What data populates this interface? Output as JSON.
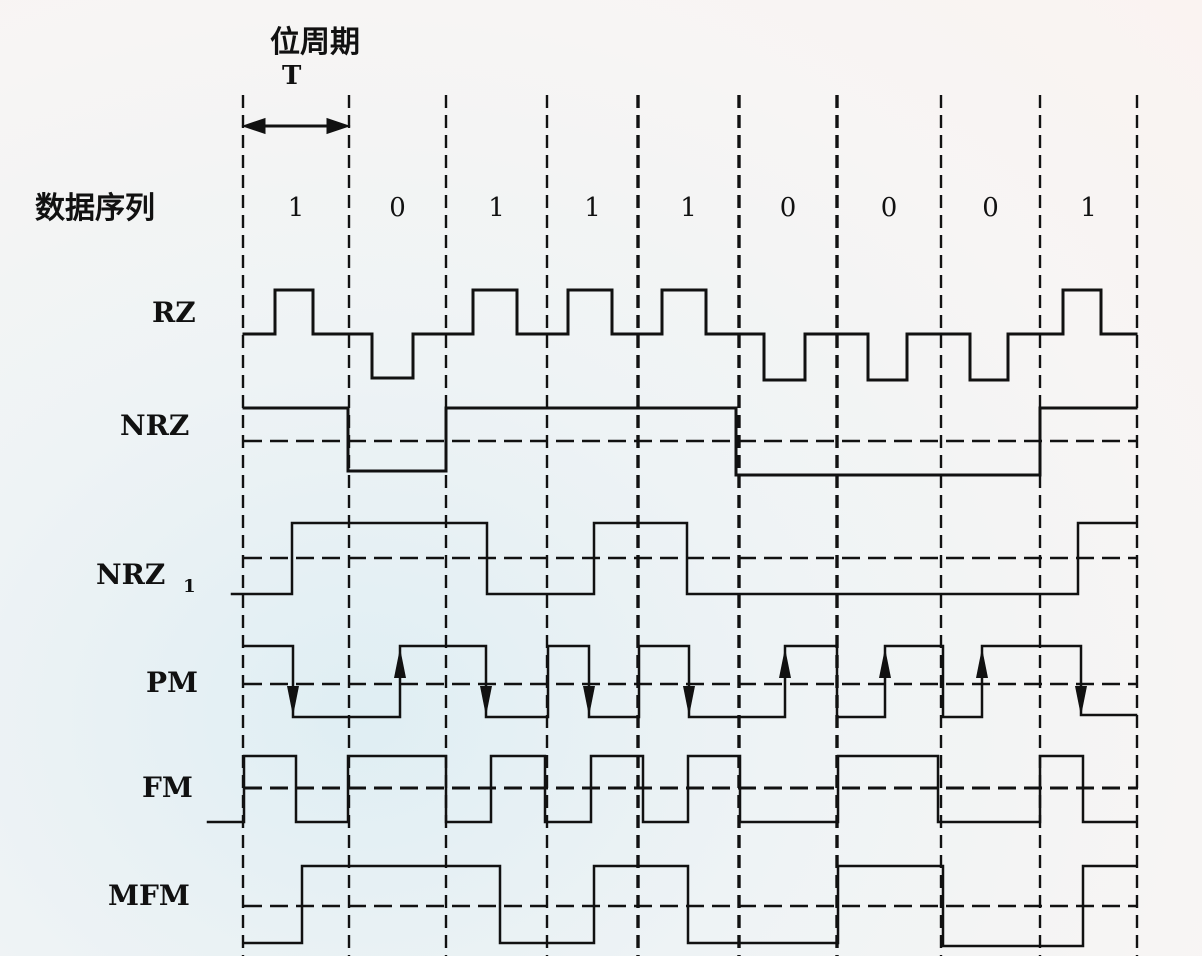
{
  "header": {
    "period_label": "位周期",
    "period_symbol": "T"
  },
  "data_row": {
    "label": "数据序列",
    "bits": [
      "1",
      "0",
      "1",
      "1",
      "1",
      "0",
      "0",
      "0",
      "1"
    ]
  },
  "signals": [
    {
      "key": "rz",
      "label": "RZ",
      "subscript": ""
    },
    {
      "key": "nrz",
      "label": "NRZ",
      "subscript": ""
    },
    {
      "key": "nrz1",
      "label": "NRZ",
      "subscript": "1"
    },
    {
      "key": "pm",
      "label": "PM",
      "subscript": ""
    },
    {
      "key": "fm",
      "label": "FM",
      "subscript": ""
    },
    {
      "key": "mfm",
      "label": "MFM",
      "subscript": ""
    }
  ]
}
